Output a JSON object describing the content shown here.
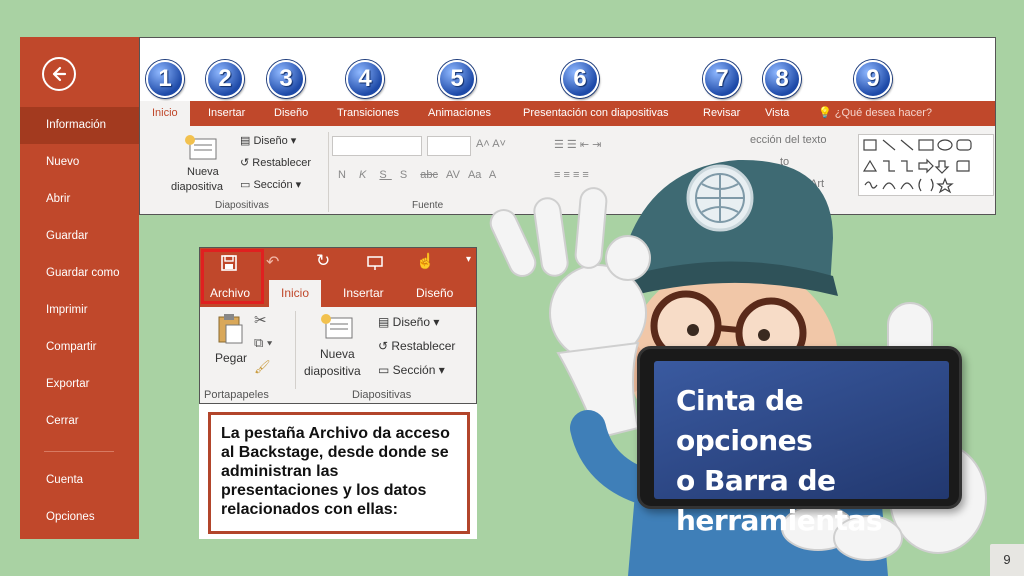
{
  "backstage": {
    "items": [
      "Información",
      "Nuevo",
      "Abrir",
      "Guardar",
      "Guardar como",
      "Imprimir",
      "Compartir",
      "Exportar",
      "Cerrar",
      "Cuenta",
      "Opciones"
    ],
    "active": "Información"
  },
  "ribbon": {
    "tabs": [
      "Inicio",
      "Insertar",
      "Diseño",
      "Transiciones",
      "Animaciones",
      "Presentación con diapositivas",
      "Revisar",
      "Vista"
    ],
    "active_tab": "Inicio",
    "tell_me": "¿Qué desea hacer?",
    "badges": [
      "1",
      "2",
      "3",
      "4",
      "5",
      "6",
      "7",
      "8",
      "9"
    ],
    "groups": {
      "diapositivas": {
        "label": "Diapositivas",
        "nueva": "Nueva",
        "diapositiva": "diapositiva",
        "diseno": "Diseño",
        "restablecer": "Restablecer",
        "seccion": "Sección"
      },
      "fuente": {
        "label": "Fuente",
        "buttons": [
          "N",
          "K",
          "S",
          "S",
          "abc",
          "AV",
          "Aa",
          "A"
        ]
      },
      "drawing": {
        "direccion": "ección del texto",
        "texto": "to",
        "smartart": "martArt"
      }
    }
  },
  "mini": {
    "tabs": [
      "Archivo",
      "Inicio",
      "Insertar",
      "Diseño"
    ],
    "active_tab": "Inicio",
    "pegar": "Pegar",
    "nueva": "Nueva",
    "diapositiva": "diapositiva",
    "diseno": "Diseño",
    "restablecer": "Restablecer",
    "seccion": "Sección",
    "portapapeles": "Portapapeles",
    "diapositivas": "Diapositivas"
  },
  "description": "La pestaña Archivo da acceso al Backstage, desde donde se administran las presentaciones y los datos relacionados con ellas:",
  "card": {
    "line1": "Cinta de opciones",
    "line2": "o Barra de",
    "line3": "herramientas"
  },
  "page_number": "9",
  "colors": {
    "background": "#a9d2a3",
    "accent": "#c0482b",
    "badge": "#1e4aa8",
    "highlight": "#e02020"
  }
}
